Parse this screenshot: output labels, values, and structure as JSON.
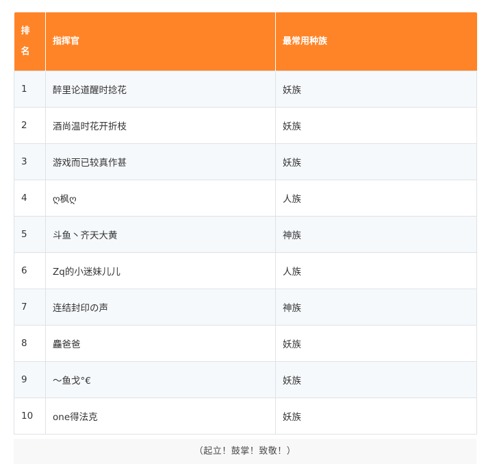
{
  "table": {
    "headers": {
      "rank": "排名",
      "rank_line1": "排",
      "rank_line2": "名",
      "commander": "指挥官",
      "race": "最常用种族"
    },
    "rows": [
      {
        "rank": "1",
        "name": "醉里论道醒时捻花",
        "race": "妖族"
      },
      {
        "rank": "2",
        "name": "酒尚温时花开折枝",
        "race": "妖族"
      },
      {
        "rank": "3",
        "name": "游戏而已较真作甚",
        "race": "妖族"
      },
      {
        "rank": "4",
        "name": "ღ枫ღ",
        "race": "人族"
      },
      {
        "rank": "5",
        "name": "斗鱼丶齐天大黄",
        "race": "神族"
      },
      {
        "rank": "6",
        "name": "Zq的小迷妹儿儿",
        "race": "人族"
      },
      {
        "rank": "7",
        "name": "连结封印の声",
        "race": "神族"
      },
      {
        "rank": "8",
        "name": "麤爸爸",
        "race": "妖族"
      },
      {
        "rank": "9",
        "name": "～鱼戈°€",
        "race": "妖族"
      },
      {
        "rank": "10",
        "name": "one得法克",
        "race": "妖族"
      }
    ]
  },
  "caption": "（起立！鼓掌！致敬！）",
  "colors": {
    "header_bg": "#ff8427",
    "header_text": "#ffffff",
    "row_alt_bg": "#f6f9fc",
    "border": "#dfe2e5"
  }
}
